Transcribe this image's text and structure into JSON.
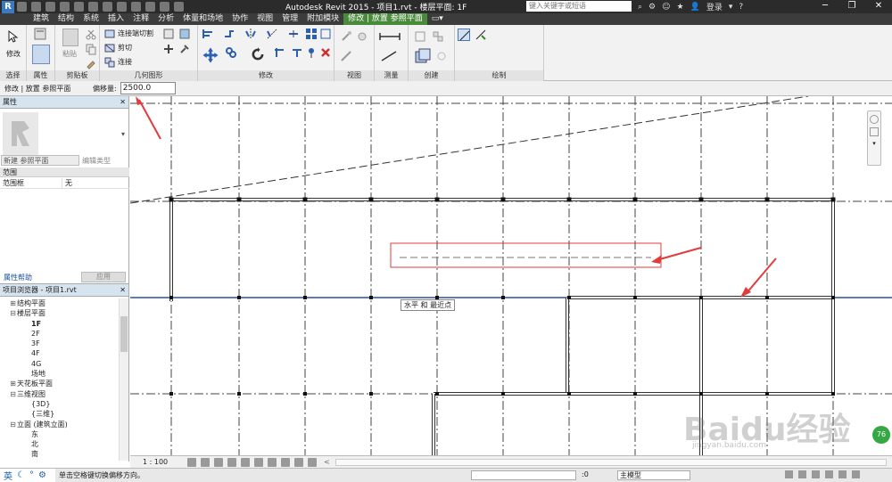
{
  "window": {
    "app_logo": "R",
    "title": "Autodesk Revit 2015 -    项目1.rvt - 楼层平面: 1F",
    "search_placeholder": "键入关键字或短语",
    "login_label": "登录"
  },
  "tabs": [
    {
      "label": "建筑"
    },
    {
      "label": "结构"
    },
    {
      "label": "系统"
    },
    {
      "label": "插入"
    },
    {
      "label": "注释"
    },
    {
      "label": "分析"
    },
    {
      "label": "体量和场地"
    },
    {
      "label": "协作"
    },
    {
      "label": "视图"
    },
    {
      "label": "管理"
    },
    {
      "label": "附加模块"
    },
    {
      "label": "修改 | 放置 参照平面"
    }
  ],
  "ribbon": {
    "modify_label": "修改",
    "paste_label": "粘贴",
    "cut_join_label": "连接端切割",
    "cut_label": "剪切",
    "join_label": "连接",
    "panels": {
      "select": "选择",
      "properties": "属性",
      "clipboard": "剪贴板",
      "geometry": "几何图形",
      "modify": "修改",
      "view": "视图",
      "measure": "测量",
      "create": "创建",
      "draw": "绘制"
    }
  },
  "options_bar": {
    "context": "修改 | 放置 参照平面",
    "offset_label": "偏移量:",
    "offset_value": "2500.0"
  },
  "properties": {
    "title": "属性",
    "type_selector": "新建 参照平面",
    "edit_type": "编辑类型",
    "group": "范围",
    "rows": [
      {
        "name": "范围框",
        "value": "无"
      }
    ],
    "help_link": "属性帮助",
    "apply": "应用"
  },
  "project_browser": {
    "title": "项目浏览器 - 项目1.rvt",
    "items": [
      {
        "label": "结构平面",
        "toggle": "⊞",
        "indent": 1
      },
      {
        "label": "楼层平面",
        "toggle": "⊟",
        "indent": 1
      },
      {
        "label": "1F",
        "toggle": "",
        "indent": 2,
        "selected": true
      },
      {
        "label": "2F",
        "toggle": "",
        "indent": 2
      },
      {
        "label": "3F",
        "toggle": "",
        "indent": 2
      },
      {
        "label": "4F",
        "toggle": "",
        "indent": 2
      },
      {
        "label": "4G",
        "toggle": "",
        "indent": 2
      },
      {
        "label": "场地",
        "toggle": "",
        "indent": 2
      },
      {
        "label": "天花板平面",
        "toggle": "⊞",
        "indent": 1
      },
      {
        "label": "三维视图",
        "toggle": "⊟",
        "indent": 1
      },
      {
        "label": "{3D}",
        "toggle": "",
        "indent": 2
      },
      {
        "label": "{三维}",
        "toggle": "",
        "indent": 2
      },
      {
        "label": "立面 (建筑立面)",
        "toggle": "⊟",
        "indent": 1
      },
      {
        "label": "东",
        "toggle": "",
        "indent": 2
      },
      {
        "label": "北",
        "toggle": "",
        "indent": 2
      },
      {
        "label": "南",
        "toggle": "",
        "indent": 2
      }
    ]
  },
  "canvas": {
    "snap_tooltip": "水平 和 最近点",
    "watermark": "Baidu经验",
    "watermark_sub": "jingyan.baidu.com",
    "badge": "76"
  },
  "view_bar": {
    "scale": "1 : 100"
  },
  "status_bar": {
    "ime_lang": "英",
    "message": "单击空格键切换偏移方向。",
    "model_label": "主模型",
    "zero_value": ":0"
  },
  "colors": {
    "ribbon_context_tab": "#4a8b3b",
    "annotation_red": "#e23b3b",
    "section_line_blue": "#2a4f9e"
  }
}
